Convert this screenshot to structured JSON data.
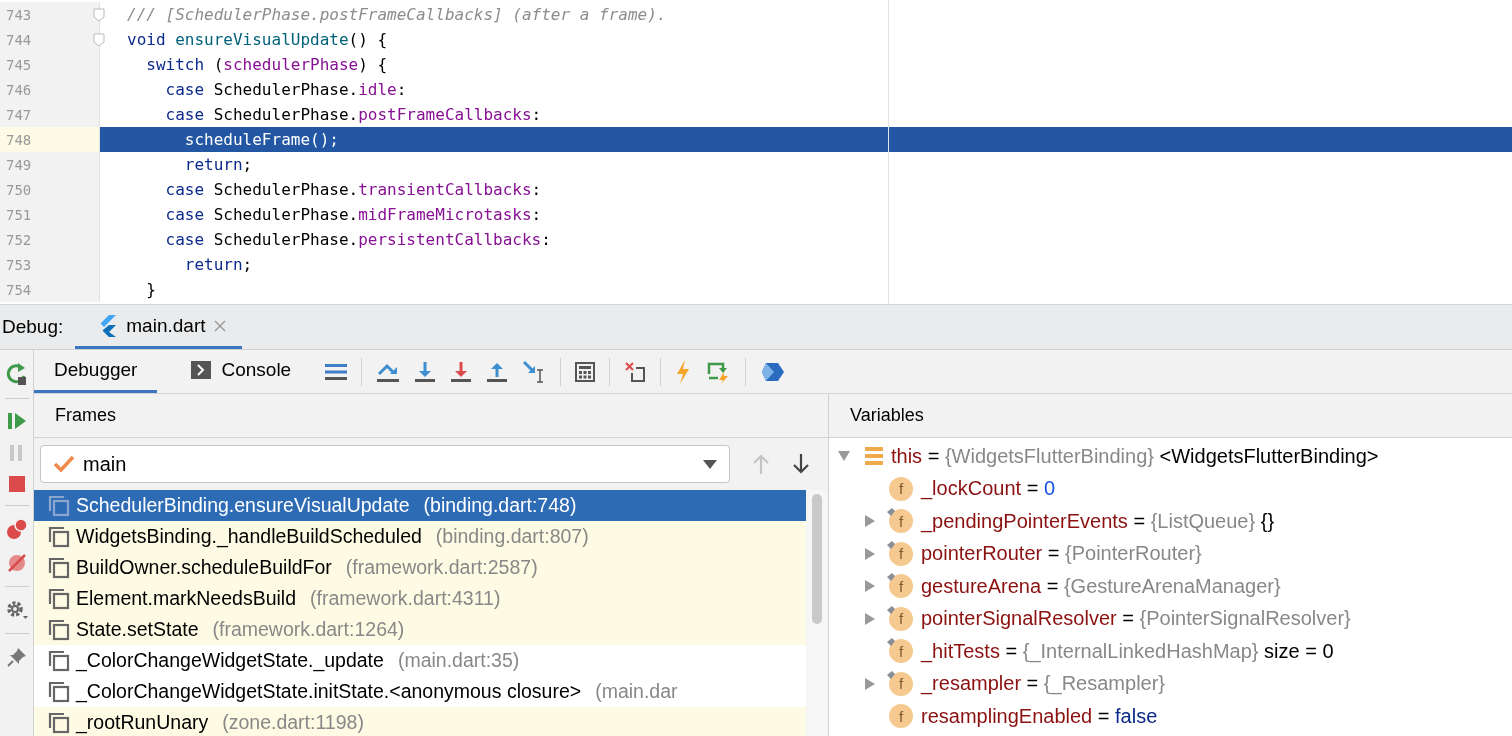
{
  "editor": {
    "lines": [
      {
        "number": "743",
        "fold": true,
        "selected": false,
        "tokens": [
          {
            "kind": "comment",
            "text": "/// [SchedulerPhase.postFrameCallbacks] (after a frame)."
          }
        ]
      },
      {
        "number": "744",
        "fold": true,
        "selected": false,
        "tokens": [
          {
            "kind": "keyword",
            "text": "void "
          },
          {
            "kind": "function",
            "text": "ensureVisualUpdate"
          },
          {
            "kind": "plain",
            "text": "() {"
          }
        ]
      },
      {
        "number": "745",
        "selected": false,
        "tokens": [
          {
            "kind": "keyword",
            "text": "  switch"
          },
          {
            "kind": "plain",
            "text": " ("
          },
          {
            "kind": "field",
            "text": "schedulerPhase"
          },
          {
            "kind": "plain",
            "text": ") {"
          }
        ]
      },
      {
        "number": "746",
        "selected": false,
        "tokens": [
          {
            "kind": "keyword",
            "text": "    case"
          },
          {
            "kind": "plain",
            "text": " SchedulerPhase."
          },
          {
            "kind": "field",
            "text": "idle"
          },
          {
            "kind": "plain",
            "text": ":"
          }
        ]
      },
      {
        "number": "747",
        "selected": false,
        "tokens": [
          {
            "kind": "keyword",
            "text": "    case"
          },
          {
            "kind": "plain",
            "text": " SchedulerPhase."
          },
          {
            "kind": "field",
            "text": "postFrameCallbacks"
          },
          {
            "kind": "plain",
            "text": ":"
          }
        ]
      },
      {
        "number": "748",
        "selected": true,
        "tokens": [
          {
            "kind": "plain",
            "text": "      scheduleFrame();"
          }
        ]
      },
      {
        "number": "749",
        "selected": false,
        "tokens": [
          {
            "kind": "keyword",
            "text": "      return"
          },
          {
            "kind": "plain",
            "text": ";"
          }
        ]
      },
      {
        "number": "750",
        "selected": false,
        "tokens": [
          {
            "kind": "keyword",
            "text": "    case"
          },
          {
            "kind": "plain",
            "text": " SchedulerPhase."
          },
          {
            "kind": "field",
            "text": "transientCallbacks"
          },
          {
            "kind": "plain",
            "text": ":"
          }
        ]
      },
      {
        "number": "751",
        "selected": false,
        "tokens": [
          {
            "kind": "keyword",
            "text": "    case"
          },
          {
            "kind": "plain",
            "text": " SchedulerPhase."
          },
          {
            "kind": "field",
            "text": "midFrameMicrotasks"
          },
          {
            "kind": "plain",
            "text": ":"
          }
        ]
      },
      {
        "number": "752",
        "selected": false,
        "tokens": [
          {
            "kind": "keyword",
            "text": "    case"
          },
          {
            "kind": "plain",
            "text": " SchedulerPhase."
          },
          {
            "kind": "field",
            "text": "persistentCallbacks"
          },
          {
            "kind": "plain",
            "text": ":"
          }
        ]
      },
      {
        "number": "753",
        "selected": false,
        "tokens": [
          {
            "kind": "keyword",
            "text": "      return"
          },
          {
            "kind": "plain",
            "text": ";"
          }
        ]
      },
      {
        "number": "754",
        "selected": false,
        "tokens": [
          {
            "kind": "plain",
            "text": "  }"
          }
        ]
      }
    ]
  },
  "debug_bar": {
    "label": "Debug:",
    "tabs": [
      {
        "label": "main.dart",
        "selected": true
      }
    ]
  },
  "toolbar": {
    "tabs": [
      {
        "label": "Debugger",
        "selected": true
      },
      {
        "label": "Console",
        "selected": false
      }
    ]
  },
  "frames": {
    "title": "Frames",
    "thread": {
      "value": "main"
    },
    "navigation": [
      {
        "kind": "up",
        "disabled": true
      },
      {
        "kind": "down",
        "disabled": false
      }
    ],
    "rows": [
      {
        "method": "SchedulerBinding.ensureVisualUpdate",
        "location": "(binding.dart:748)",
        "selected": true,
        "highlighted": true
      },
      {
        "method": "WidgetsBinding._handleBuildScheduled",
        "location": "(binding.dart:807)",
        "selected": false,
        "highlighted": true
      },
      {
        "method": "BuildOwner.scheduleBuildFor",
        "location": "(framework.dart:2587)",
        "selected": false,
        "highlighted": true
      },
      {
        "method": "Element.markNeedsBuild",
        "location": "(framework.dart:4311)",
        "selected": false,
        "highlighted": true
      },
      {
        "method": "State.setState",
        "location": "(framework.dart:1264)",
        "selected": false,
        "highlighted": true
      },
      {
        "method": "_ColorChangeWidgetState._update",
        "location": "(main.dart:35)",
        "selected": false,
        "highlighted": false
      },
      {
        "method": "_ColorChangeWidgetState.initState.<anonymous closure>",
        "location": "(main.dar",
        "selected": false,
        "highlighted": false
      },
      {
        "method": "_rootRunUnary",
        "location": "(zone.dart:1198)",
        "selected": false,
        "highlighted": true
      }
    ]
  },
  "variables": {
    "title": "Variables",
    "items": [
      {
        "kind": "object",
        "name": "this",
        "equals": "=",
        "type": "{WidgetsFlutterBinding}",
        "value": {
          "kind": "plain",
          "text": "<WidgetsFlutterBinding>"
        },
        "expanded": true,
        "children": [
          {
            "kind": "field",
            "badge": "f",
            "marked": false,
            "name": "_lockCount",
            "equals": "=",
            "value": {
              "kind": "number",
              "text": "0"
            }
          },
          {
            "kind": "field",
            "badge": "f",
            "marked": true,
            "name": "_pendingPointerEvents",
            "equals": "=",
            "type": "{ListQueue}",
            "value": {
              "kind": "plain",
              "text": "{}"
            },
            "expanded": false
          },
          {
            "kind": "field",
            "badge": "f",
            "marked": true,
            "name": "pointerRouter",
            "equals": "=",
            "type": "{PointerRouter}",
            "expanded": false
          },
          {
            "kind": "field",
            "badge": "f",
            "marked": true,
            "name": "gestureArena",
            "equals": "=",
            "type": "{GestureArenaManager}",
            "expanded": false
          },
          {
            "kind": "field",
            "badge": "f",
            "marked": true,
            "name": "pointerSignalResolver",
            "equals": "=",
            "type": "{PointerSignalResolver}",
            "expanded": false
          },
          {
            "kind": "field",
            "badge": "f",
            "marked": true,
            "name": "_hitTests",
            "equals": "=",
            "type": "{_InternalLinkedHashMap}",
            "value": {
              "kind": "plain",
              "text": "size = 0"
            }
          },
          {
            "kind": "field",
            "badge": "f",
            "marked": true,
            "name": "_resampler",
            "equals": "=",
            "type": "{_Resampler}",
            "expanded": false
          },
          {
            "kind": "field",
            "badge": "f",
            "marked": false,
            "name": "resamplingEnabled",
            "equals": "=",
            "value": {
              "kind": "boolean",
              "text": "false"
            }
          }
        ]
      }
    ]
  }
}
